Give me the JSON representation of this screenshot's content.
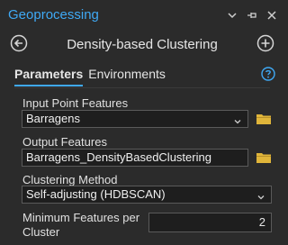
{
  "app": {
    "title": "Geoprocessing"
  },
  "nav": {
    "tool_title": "Density-based Clustering"
  },
  "tabs": [
    {
      "label": "Parameters",
      "active": true
    },
    {
      "label": "Environments",
      "active": false
    }
  ],
  "params": {
    "input_point_features": {
      "label": "Input Point Features",
      "value": "Barragens"
    },
    "output_features": {
      "label": "Output Features",
      "value": "Barragens_DensityBasedClustering"
    },
    "clustering_method": {
      "label": "Clustering Method",
      "value": "Self-adjusting (HDBSCAN)"
    },
    "min_features": {
      "label_line1": "Minimum Features per",
      "label_line2": "Cluster",
      "value": "2"
    }
  },
  "colors": {
    "accent": "#3fa9f5",
    "folder": "#e0b53a",
    "background": "#2b2b2b"
  },
  "icons": [
    "chevron-down-icon",
    "pin-icon",
    "close-icon",
    "back-icon",
    "add-icon",
    "help-icon",
    "folder-icon"
  ]
}
